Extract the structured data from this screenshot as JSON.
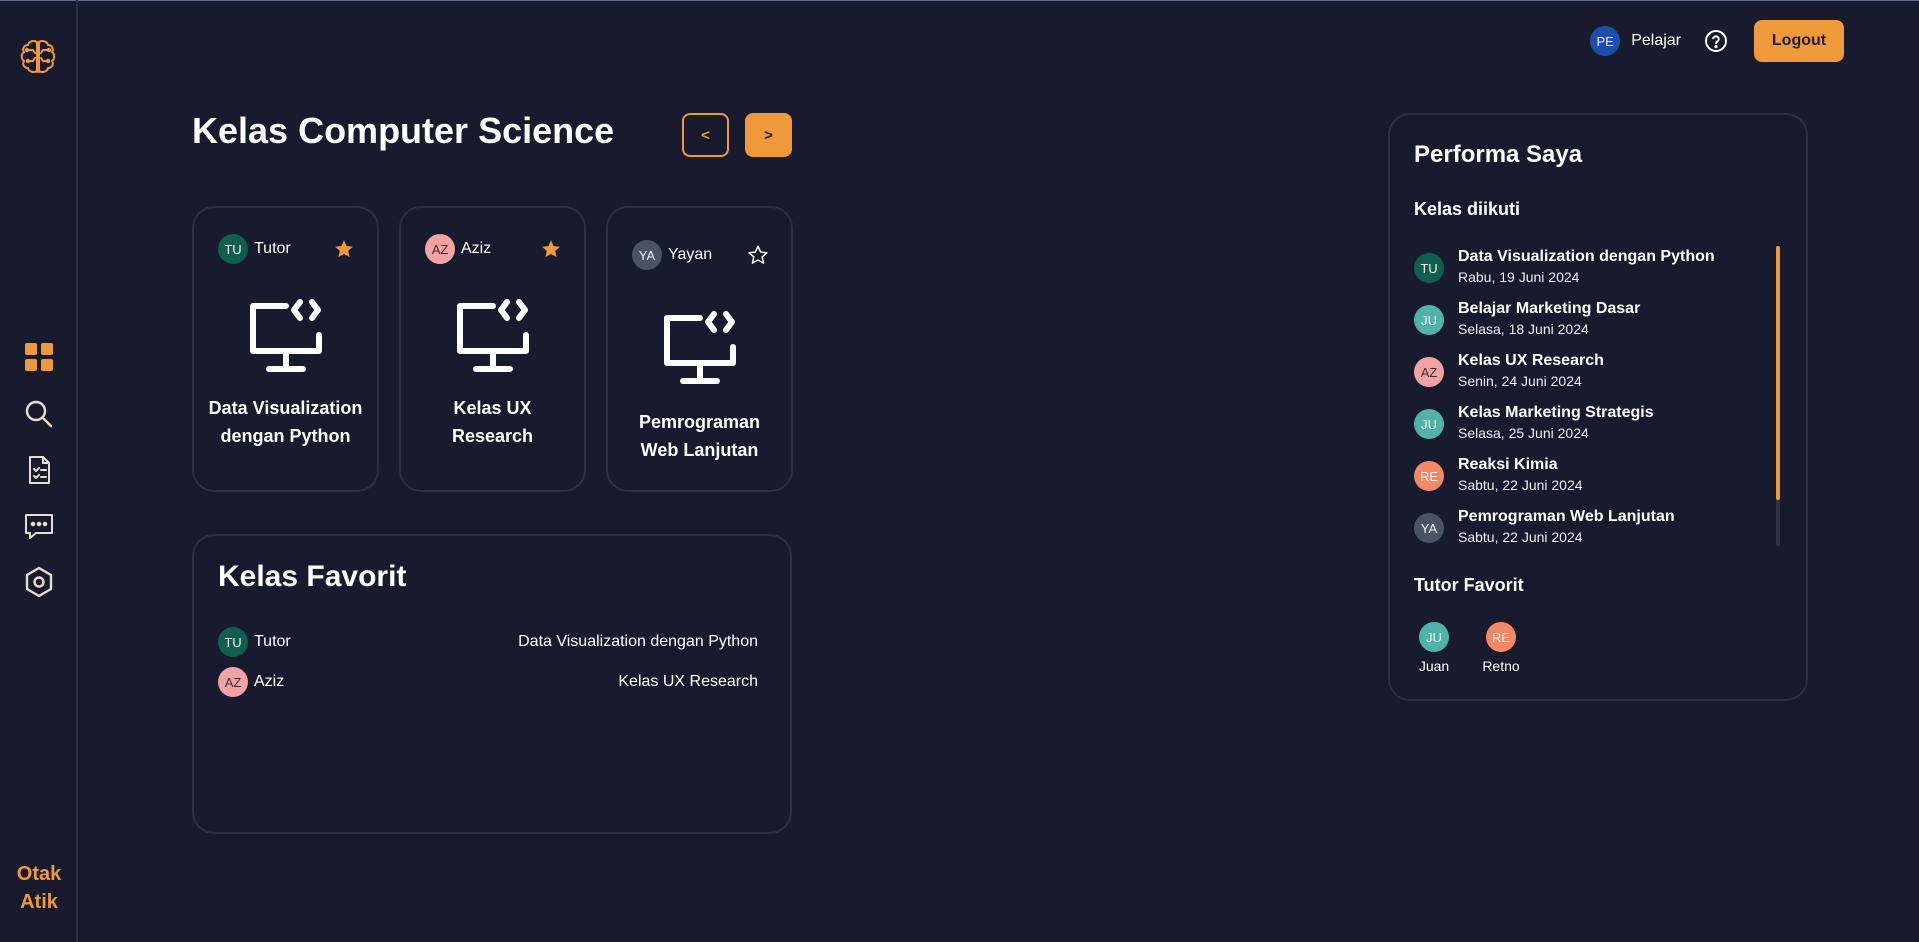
{
  "brand": {
    "line1": "Otak",
    "line2": "Atik"
  },
  "sidebar": {
    "items": [
      {
        "name": "dashboard",
        "icon": "dashboard-grid-icon",
        "active": true
      },
      {
        "name": "search",
        "icon": "search-icon"
      },
      {
        "name": "tasks",
        "icon": "checklist-icon"
      },
      {
        "name": "chat",
        "icon": "chat-icon"
      },
      {
        "name": "settings",
        "icon": "settings-icon"
      }
    ]
  },
  "header": {
    "user_initials": "PE",
    "user_name": "Pelajar",
    "logout_label": "Logout"
  },
  "main": {
    "title": "Kelas Computer Science",
    "prev_label": "<",
    "next_label": ">",
    "classes": [
      {
        "tutor_initials": "TU",
        "tutor": "Tutor",
        "title": "Data Visualization dengan Python",
        "favorited": true
      },
      {
        "tutor_initials": "AZ",
        "tutor": "Aziz",
        "title": "Kelas UX Research",
        "favorited": true
      },
      {
        "tutor_initials": "YA",
        "tutor": "Yayan",
        "title": "Pemrograman Web Lanjutan",
        "favorited": false
      }
    ]
  },
  "favorites": {
    "title": "Kelas Favorit",
    "items": [
      {
        "initials": "TU",
        "tutor": "Tutor",
        "class": "Data Visualization dengan Python"
      },
      {
        "initials": "AZ",
        "tutor": "Aziz",
        "class": "Kelas UX Research"
      }
    ]
  },
  "performance": {
    "title": "Performa Saya",
    "followed_label": "Kelas diikuti",
    "followed": [
      {
        "initials": "TU",
        "name": "Data Visualization dengan Python",
        "date": "Rabu, 19 Juni 2024"
      },
      {
        "initials": "JU",
        "name": "Belajar Marketing Dasar",
        "date": "Selasa, 18 Juni 2024"
      },
      {
        "initials": "AZ",
        "name": "Kelas UX Research",
        "date": "Senin, 24 Juni 2024"
      },
      {
        "initials": "JU",
        "name": "Kelas Marketing Strategis",
        "date": "Selasa, 25 Juni 2024"
      },
      {
        "initials": "RE",
        "name": "Reaksi Kimia",
        "date": "Sabtu, 22 Juni 2024"
      },
      {
        "initials": "YA",
        "name": "Pemrograman Web Lanjutan",
        "date": "Sabtu, 22 Juni 2024"
      }
    ],
    "tutor_fav_label": "Tutor Favorit",
    "tutor_favs": [
      {
        "initials": "JU",
        "name": "Juan"
      },
      {
        "initials": "RE",
        "name": "Retno"
      }
    ]
  },
  "colors": {
    "background": "#181a2e",
    "accent": "#f0993a",
    "border": "#2b2f48",
    "avatar_TU": "#0f5e4e",
    "avatar_AZ": "#f2a1a4",
    "avatar_YA": "#475563",
    "avatar_JU": "#4fb3a9",
    "avatar_RE": "#f48764",
    "avatar_PE": "#1e4fa8"
  }
}
